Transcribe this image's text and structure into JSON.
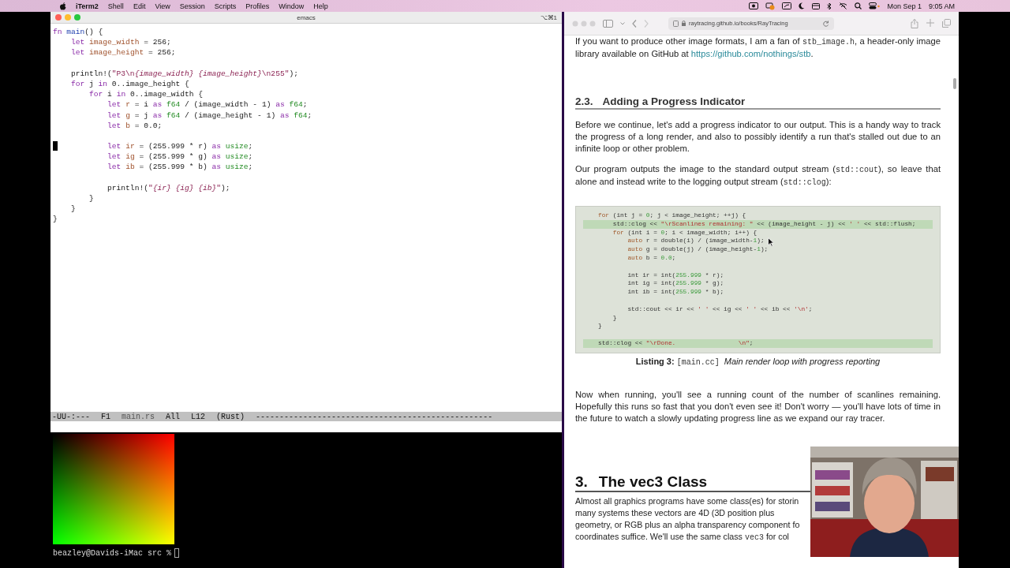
{
  "menu_bar": {
    "app": "iTerm2",
    "menus": [
      "Shell",
      "Edit",
      "View",
      "Session",
      "Scripts",
      "Profiles",
      "Window",
      "Help"
    ],
    "date": "Mon Sep 1",
    "time": "9:05 AM"
  },
  "terminal_window": {
    "title": "emacs",
    "shortcut": "⌥⌘1",
    "editor": {
      "lines": [
        {
          "cursor": false,
          "tokens": [
            {
              "kind": "keyword",
              "text": "fn "
            },
            {
              "kind": "function",
              "text": "main"
            },
            {
              "kind": "plain",
              "text": "() {"
            }
          ]
        },
        {
          "cursor": false,
          "tokens": [
            {
              "kind": "keyword",
              "text": "    let "
            },
            {
              "kind": "variable",
              "text": "image_width"
            },
            {
              "kind": "plain",
              "text": " = 256;"
            }
          ]
        },
        {
          "cursor": false,
          "tokens": [
            {
              "kind": "keyword",
              "text": "    let "
            },
            {
              "kind": "variable",
              "text": "image_height"
            },
            {
              "kind": "plain",
              "text": " = 256;"
            }
          ]
        },
        {
          "cursor": false
        },
        {
          "cursor": false,
          "tokens": [
            {
              "kind": "plain",
              "text": "    println!("
            },
            {
              "kind": "string",
              "text": "\"P3\\n"
            },
            {
              "kind": "interp",
              "text": "{image_width} "
            },
            {
              "kind": "interp",
              "text": "{image_height}"
            },
            {
              "kind": "string",
              "text": "\\n255\""
            },
            {
              "kind": "plain",
              "text": ");"
            }
          ]
        },
        {
          "cursor": false,
          "tokens": [
            {
              "kind": "keyword",
              "text": "    for"
            },
            {
              "kind": "plain",
              "text": " j "
            },
            {
              "kind": "keyword",
              "text": "in"
            },
            {
              "kind": "plain",
              "text": " 0..image_height {"
            }
          ]
        },
        {
          "cursor": false,
          "tokens": [
            {
              "kind": "keyword",
              "text": "        for"
            },
            {
              "kind": "plain",
              "text": " i "
            },
            {
              "kind": "keyword",
              "text": "in"
            },
            {
              "kind": "plain",
              "text": " 0..image_width {"
            }
          ]
        },
        {
          "cursor": false,
          "tokens": [
            {
              "kind": "keyword",
              "text": "            let "
            },
            {
              "kind": "variable",
              "text": "r"
            },
            {
              "kind": "plain",
              "text": " = i "
            },
            {
              "kind": "keyword",
              "text": "as "
            },
            {
              "kind": "type",
              "text": "f64"
            },
            {
              "kind": "plain",
              "text": " / (image_width - 1) "
            },
            {
              "kind": "keyword",
              "text": "as "
            },
            {
              "kind": "type",
              "text": "f64"
            },
            {
              "kind": "plain",
              "text": ";"
            }
          ]
        },
        {
          "cursor": false,
          "tokens": [
            {
              "kind": "keyword",
              "text": "            let "
            },
            {
              "kind": "variable",
              "text": "g"
            },
            {
              "kind": "plain",
              "text": " = j "
            },
            {
              "kind": "keyword",
              "text": "as "
            },
            {
              "kind": "type",
              "text": "f64"
            },
            {
              "kind": "plain",
              "text": " / (image_height - 1) "
            },
            {
              "kind": "keyword",
              "text": "as "
            },
            {
              "kind": "type",
              "text": "f64"
            },
            {
              "kind": "plain",
              "text": ";"
            }
          ]
        },
        {
          "cursor": false,
          "tokens": [
            {
              "kind": "keyword",
              "text": "            let "
            },
            {
              "kind": "variable",
              "text": "b"
            },
            {
              "kind": "plain",
              "text": " = 0.0;"
            }
          ]
        },
        {
          "cursor": false
        },
        {
          "cursor": true,
          "tokens": [
            {
              "kind": "keyword",
              "text": "            let "
            },
            {
              "kind": "variable",
              "text": "ir"
            },
            {
              "kind": "plain",
              "text": " = (255.999 * r) "
            },
            {
              "kind": "keyword",
              "text": "as "
            },
            {
              "kind": "type",
              "text": "usize"
            },
            {
              "kind": "plain",
              "text": ";"
            }
          ]
        },
        {
          "cursor": false,
          "tokens": [
            {
              "kind": "keyword",
              "text": "            let "
            },
            {
              "kind": "variable",
              "text": "ig"
            },
            {
              "kind": "plain",
              "text": " = (255.999 * g) "
            },
            {
              "kind": "keyword",
              "text": "as "
            },
            {
              "kind": "type",
              "text": "usize"
            },
            {
              "kind": "plain",
              "text": ";"
            }
          ]
        },
        {
          "cursor": false,
          "tokens": [
            {
              "kind": "keyword",
              "text": "            let "
            },
            {
              "kind": "variable",
              "text": "ib"
            },
            {
              "kind": "plain",
              "text": " = (255.999 * b) "
            },
            {
              "kind": "keyword",
              "text": "as "
            },
            {
              "kind": "type",
              "text": "usize"
            },
            {
              "kind": "plain",
              "text": ";"
            }
          ]
        },
        {
          "cursor": false
        },
        {
          "cursor": false,
          "tokens": [
            {
              "kind": "plain",
              "text": "            println!("
            },
            {
              "kind": "string",
              "text": "\""
            },
            {
              "kind": "interp",
              "text": "{ir} "
            },
            {
              "kind": "interp",
              "text": "{ig} "
            },
            {
              "kind": "interp",
              "text": "{ib}"
            },
            {
              "kind": "string",
              "text": "\""
            },
            {
              "kind": "plain",
              "text": ");"
            }
          ]
        },
        {
          "cursor": false,
          "tokens": [
            {
              "kind": "plain",
              "text": "        }"
            }
          ]
        },
        {
          "cursor": false,
          "tokens": [
            {
              "kind": "plain",
              "text": "    }"
            }
          ]
        },
        {
          "cursor": false,
          "tokens": [
            {
              "kind": "plain",
              "text": "}"
            }
          ]
        }
      ]
    },
    "mode_line": {
      "state": "-UU-:---",
      "frame": "F1",
      "buffer": "main.rs",
      "extent": "All",
      "line": "L12",
      "mode": "(Rust)",
      "fill": "--------------------------------------------------"
    },
    "output": {
      "prompt": "beazley@Davids-iMac src %"
    }
  },
  "browser": {
    "address": "raytracing.github.io/books/RayTracing",
    "blocks": [
      {
        "kind": "paragraph",
        "parts": [
          {
            "kind": "text",
            "text": "If you want to produce other image formats, I am a fan of "
          },
          {
            "kind": "code",
            "text": "stb_image.h"
          },
          {
            "kind": "text",
            "text": ", a header-only image library available on GitHub at "
          },
          {
            "kind": "link",
            "text": "https://github.com/nothings/stb"
          },
          {
            "kind": "text",
            "text": "."
          }
        ]
      },
      {
        "kind": "section",
        "number": "2.3.",
        "title": "Adding a Progress Indicator"
      },
      {
        "kind": "paragraph",
        "parts": [
          {
            "kind": "text",
            "text": "Before we continue, let's add a progress indicator to our output. This is a handy way to track the progress of a long render, and also to possibly identify a run that's stalled out due to an infinite loop or other problem."
          }
        ]
      },
      {
        "kind": "paragraph",
        "parts": [
          {
            "kind": "text",
            "text": "Our program outputs the image to the standard output stream ("
          },
          {
            "kind": "code",
            "text": "std::cout"
          },
          {
            "kind": "text",
            "text": "), so leave that alone and instead write to the logging output stream ("
          },
          {
            "kind": "code",
            "text": "std::clog"
          },
          {
            "kind": "text",
            "text": "):"
          }
        ]
      },
      {
        "kind": "listing",
        "lines": [
          {
            "highlighted": false,
            "tokens": [
              {
                "kind": "keyword",
                "text": "for"
              },
              {
                "kind": "plain",
                "text": " (int j = "
              },
              {
                "kind": "number",
                "text": "0"
              },
              {
                "kind": "plain",
                "text": "; j < image_height; ++j) {"
              }
            ]
          },
          {
            "highlighted": true,
            "tokens": [
              {
                "kind": "plain",
                "text": "    std::clog << "
              },
              {
                "kind": "string",
                "text": "\"\\rScanlines remaining: \""
              },
              {
                "kind": "plain",
                "text": " << (image_height - j) << "
              },
              {
                "kind": "string",
                "text": "' '"
              },
              {
                "kind": "plain",
                "text": " << std::flush;"
              }
            ]
          },
          {
            "highlighted": false,
            "tokens": [
              {
                "kind": "keyword",
                "text": "    for"
              },
              {
                "kind": "plain",
                "text": " (int i = "
              },
              {
                "kind": "number",
                "text": "0"
              },
              {
                "kind": "plain",
                "text": "; i < image_width; i++) {"
              }
            ]
          },
          {
            "highlighted": false,
            "tokens": [
              {
                "kind": "keyword",
                "text": "        auto"
              },
              {
                "kind": "plain",
                "text": " r = double(i) / (image_width-"
              },
              {
                "kind": "number",
                "text": "1"
              },
              {
                "kind": "plain",
                "text": ");"
              }
            ]
          },
          {
            "highlighted": false,
            "tokens": [
              {
                "kind": "keyword",
                "text": "        auto"
              },
              {
                "kind": "plain",
                "text": " g = double(j) / (image_height-"
              },
              {
                "kind": "number",
                "text": "1"
              },
              {
                "kind": "plain",
                "text": ");"
              }
            ]
          },
          {
            "highlighted": false,
            "tokens": [
              {
                "kind": "keyword",
                "text": "        auto"
              },
              {
                "kind": "plain",
                "text": " b = "
              },
              {
                "kind": "number",
                "text": "0.0"
              },
              {
                "kind": "plain",
                "text": ";"
              }
            ]
          },
          {
            "highlighted": false
          },
          {
            "highlighted": false,
            "tokens": [
              {
                "kind": "plain",
                "text": "        int ir = int("
              },
              {
                "kind": "number",
                "text": "255.999"
              },
              {
                "kind": "plain",
                "text": " * r);"
              }
            ]
          },
          {
            "highlighted": false,
            "tokens": [
              {
                "kind": "plain",
                "text": "        int ig = int("
              },
              {
                "kind": "number",
                "text": "255.999"
              },
              {
                "kind": "plain",
                "text": " * g);"
              }
            ]
          },
          {
            "highlighted": false,
            "tokens": [
              {
                "kind": "plain",
                "text": "        int ib = int("
              },
              {
                "kind": "number",
                "text": "255.999"
              },
              {
                "kind": "plain",
                "text": " * b);"
              }
            ]
          },
          {
            "highlighted": false
          },
          {
            "highlighted": false,
            "tokens": [
              {
                "kind": "plain",
                "text": "        std::cout << ir << "
              },
              {
                "kind": "string",
                "text": "' '"
              },
              {
                "kind": "plain",
                "text": " << ig << "
              },
              {
                "kind": "string",
                "text": "' '"
              },
              {
                "kind": "plain",
                "text": " << ib << "
              },
              {
                "kind": "string",
                "text": "'\\n'"
              },
              {
                "kind": "plain",
                "text": ";"
              }
            ]
          },
          {
            "highlighted": false,
            "tokens": [
              {
                "kind": "plain",
                "text": "    }"
              }
            ]
          },
          {
            "highlighted": false,
            "tokens": [
              {
                "kind": "plain",
                "text": "}"
              }
            ]
          },
          {
            "highlighted": false
          },
          {
            "highlighted": true,
            "tokens": [
              {
                "kind": "plain",
                "text": "std::clog << "
              },
              {
                "kind": "string",
                "text": "\"\\rDone.                 \\n\""
              },
              {
                "kind": "plain",
                "text": ";"
              }
            ]
          }
        ]
      },
      {
        "kind": "caption",
        "parts": [
          {
            "kind": "bold",
            "text": "Listing 3: "
          },
          {
            "kind": "code",
            "text": "[main.cc] "
          },
          {
            "kind": "italic",
            "text": "Main render loop with progress reporting"
          }
        ]
      },
      {
        "kind": "paragraph",
        "parts": [
          {
            "kind": "text",
            "text": "Now when running, you'll see a running count of the number of scanlines remaining. Hopefully this runs so fast that you don't even see it! Don't worry — you'll have lots of time in the future to watch a slowly updating progress line as we expand our ray tracer."
          }
        ]
      },
      {
        "kind": "chapter",
        "number": "3.",
        "title": "The vec3 Class"
      },
      {
        "kind": "clipped",
        "lines": [
          [
            {
              "kind": "text",
              "text": "Almost all graphics programs have some class(es) for storin"
            }
          ],
          [
            {
              "kind": "text",
              "text": "many systems these vectors are 4D (3D position plus"
            }
          ],
          [
            {
              "kind": "text",
              "text": "geometry, or RGB plus an alpha transparency component fo"
            }
          ],
          [
            {
              "kind": "text",
              "text": "coordinates suffice. We'll use the same class "
            },
            {
              "kind": "code",
              "text": "vec3"
            },
            {
              "kind": "text",
              "text": " for col"
            }
          ]
        ]
      }
    ]
  }
}
